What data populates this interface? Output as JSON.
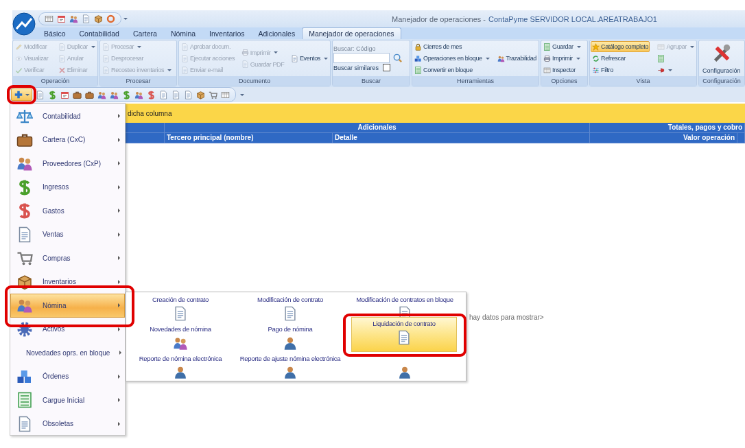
{
  "window": {
    "title": "Manejador de operaciones -",
    "context": "ContaPyme SERVIDOR LOCAL.AREATRABAJO1"
  },
  "tabs": [
    {
      "label": "Básico",
      "selected": false
    },
    {
      "label": "Contabilidad",
      "selected": false
    },
    {
      "label": "Cartera",
      "selected": false
    },
    {
      "label": "Nómina",
      "selected": false
    },
    {
      "label": "Inventarios",
      "selected": false
    },
    {
      "label": "Adicionales",
      "selected": false
    },
    {
      "label": "Manejador de operaciones",
      "selected": true
    }
  ],
  "ribbon": {
    "groups": [
      {
        "label": "Operación",
        "columns": [
          [
            {
              "kind": "button",
              "label": "Modificar",
              "disabled": true,
              "dropdown": false
            },
            {
              "kind": "button",
              "label": "Visualizar",
              "disabled": true,
              "dropdown": false
            },
            {
              "kind": "button",
              "label": "Verificar",
              "disabled": true,
              "dropdown": false
            }
          ],
          [
            {
              "kind": "button",
              "label": "Duplicar",
              "disabled": true,
              "dropdown": true
            },
            {
              "kind": "button",
              "label": "Anular",
              "disabled": true,
              "dropdown": false
            },
            {
              "kind": "button",
              "label": "Eliminar",
              "disabled": true,
              "dropdown": false
            }
          ]
        ]
      },
      {
        "label": "Procesar",
        "columns": [
          [
            {
              "kind": "button",
              "label": "Procesar",
              "disabled": true,
              "dropdown": true
            },
            {
              "kind": "button",
              "label": "Desprocesar",
              "disabled": true,
              "dropdown": false
            },
            {
              "kind": "button",
              "label": "Recosteo inventarios",
              "disabled": true,
              "dropdown": true
            }
          ]
        ]
      },
      {
        "label": "Documento",
        "columns": [
          [
            {
              "kind": "button",
              "label": "Aprobar docum.",
              "disabled": true,
              "dropdown": false
            },
            {
              "kind": "button",
              "label": "Ejecutar acciones",
              "disabled": true,
              "dropdown": false
            },
            {
              "kind": "button",
              "label": "Enviar e-mail",
              "disabled": true,
              "dropdown": false
            }
          ],
          [
            {
              "kind": "button",
              "label": "Imprimir",
              "disabled": true,
              "dropdown": true
            },
            {
              "kind": "button",
              "label": "Guardar PDF",
              "disabled": true,
              "dropdown": false
            }
          ],
          [
            {
              "kind": "button",
              "label": "Eventos",
              "disabled": false,
              "dropdown": true
            }
          ]
        ]
      },
      {
        "label": "Buscar",
        "columns": [
          [
            {
              "kind": "caption",
              "label": "Buscar: Código"
            },
            {
              "kind": "field"
            },
            {
              "kind": "checkbox",
              "label": "Buscar similares",
              "checked": false
            }
          ]
        ]
      },
      {
        "label": "Herramientas",
        "columns": [
          [
            {
              "kind": "button",
              "label": "Cierres de mes",
              "disabled": false,
              "dropdown": false
            },
            {
              "kind": "button",
              "label": "Operaciones en bloque",
              "disabled": false,
              "dropdown": true
            },
            {
              "kind": "button",
              "label": "Convertir en bloque",
              "disabled": false,
              "dropdown": false
            }
          ],
          [
            {
              "kind": "button",
              "label": "Trazabilidad",
              "disabled": false,
              "dropdown": false
            }
          ]
        ]
      },
      {
        "label": "Opciones",
        "columns": [
          [
            {
              "kind": "button",
              "label": "Guardar",
              "disabled": false,
              "dropdown": true
            },
            {
              "kind": "button",
              "label": "Imprimir",
              "disabled": false,
              "dropdown": true
            },
            {
              "kind": "button",
              "label": "Inspector",
              "disabled": false,
              "dropdown": false
            }
          ]
        ]
      },
      {
        "label": "Vista",
        "columns": [
          [
            {
              "kind": "button",
              "label": "Catálogo completo",
              "disabled": false,
              "dropdown": false,
              "on": true
            },
            {
              "kind": "button",
              "label": "Refrescar",
              "disabled": false,
              "dropdown": false,
              "on": false
            },
            {
              "kind": "button",
              "label": "Filtro",
              "disabled": false,
              "dropdown": false,
              "on": false
            }
          ],
          [
            {
              "kind": "button",
              "label": "Agrupar",
              "disabled": true,
              "dropdown": true,
              "on": false
            },
            {
              "kind": "button",
              "disabled": false,
              "dropdown": false,
              "on": false
            },
            {
              "kind": "button",
              "disabled": false,
              "dropdown": true,
              "on": false
            }
          ]
        ]
      },
      {
        "label": "Configuración",
        "columns": [
          [
            {
              "kind": "large",
              "label": "Configuración",
              "disabled": false,
              "dropdown": false
            }
          ]
        ]
      }
    ]
  },
  "toolbar": {
    "add_button": {
      "highlighted": true
    }
  },
  "grid": {
    "grouping_hint": "dicha columna",
    "column_groups": [
      "Adicionales",
      "Totales, pagos y cobro"
    ],
    "columns": [
      "Tercero principal (nombre)",
      "Detalle",
      "Valor operación"
    ],
    "empty_message": "hay datos para mostrar>"
  },
  "menu": {
    "items": [
      {
        "label": "Contabilidad",
        "selected": false,
        "highlighted": false
      },
      {
        "label": "Cartera (CxC)",
        "selected": false,
        "highlighted": false
      },
      {
        "label": "Proveedores (CxP)",
        "selected": false,
        "highlighted": false
      },
      {
        "label": "Ingresos",
        "selected": false,
        "highlighted": false
      },
      {
        "label": "Gastos",
        "selected": false,
        "highlighted": false
      },
      {
        "label": "Ventas",
        "selected": false,
        "highlighted": false
      },
      {
        "label": "Compras",
        "selected": false,
        "highlighted": false
      },
      {
        "label": "Inventarios",
        "selected": false,
        "highlighted": false
      },
      {
        "label": "Nómina",
        "selected": true,
        "highlighted": true
      },
      {
        "label": "Activos",
        "selected": false,
        "highlighted": false
      },
      {
        "label": "Novedades oprs. en bloque",
        "selected": false,
        "highlighted": false
      },
      {
        "label": "Órdenes",
        "selected": false,
        "highlighted": false
      },
      {
        "label": "Cargue Inicial",
        "selected": false,
        "highlighted": false
      },
      {
        "label": "Obsoletas",
        "selected": false,
        "highlighted": false
      }
    ]
  },
  "submenu": {
    "items": [
      {
        "label": "Creación de contrato",
        "selected": false,
        "highlighted": false
      },
      {
        "label": "Modificación de contrato",
        "selected": false,
        "highlighted": false
      },
      {
        "label": "Modificación de contratos en bloque",
        "selected": false,
        "highlighted": false
      },
      {
        "label": "Novedades de nómina",
        "selected": false,
        "highlighted": false
      },
      {
        "label": "Pago de nómina",
        "selected": false,
        "highlighted": false
      },
      {
        "label": "Liquidación de contrato",
        "selected": true,
        "highlighted": true
      },
      {
        "label": "Reporte de nómina electrónica",
        "selected": false,
        "highlighted": false
      },
      {
        "label": "Reporte de ajuste nómina electrónica",
        "selected": false,
        "highlighted": false
      },
      {
        "selected": false,
        "highlighted": false
      }
    ]
  }
}
